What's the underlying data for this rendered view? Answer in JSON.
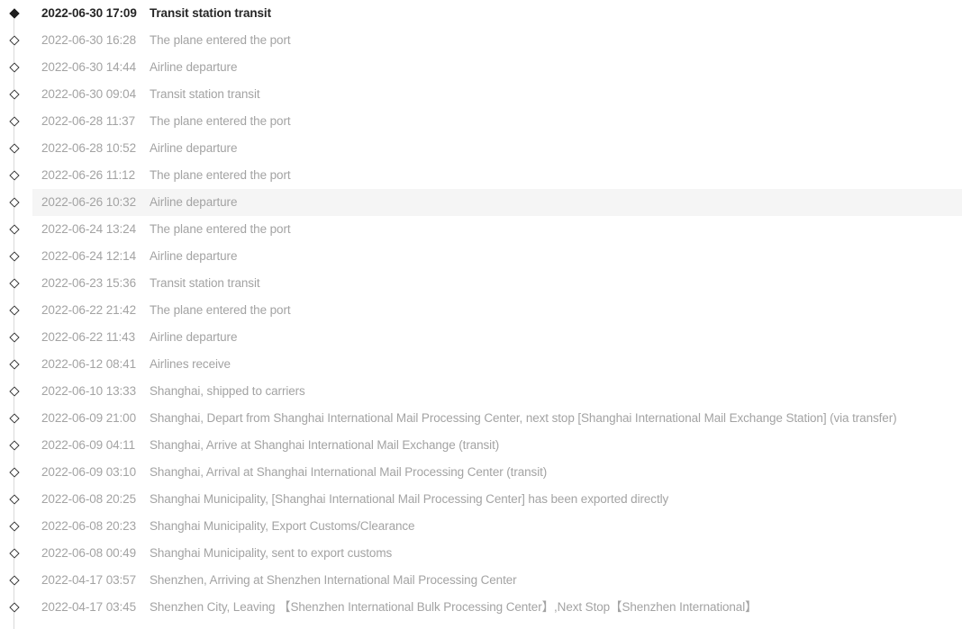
{
  "colors": {
    "active_text": "#262626",
    "muted_text": "#a3a3a3",
    "hover_row_background": "#f5f5f5",
    "connector_line": "#d9d9d9",
    "marker_outline": "#3a3a3a",
    "marker_active_fill": "#1f1f1f",
    "page_background": "#ffffff"
  },
  "timeline": {
    "marker_icon_active": "filled-diamond-icon",
    "marker_icon_inactive": "hollow-diamond-icon",
    "events": [
      {
        "timestamp": "2022-06-30 17:09",
        "description": "Transit station transit",
        "state": "active",
        "hovered": false
      },
      {
        "timestamp": "2022-06-30 16:28",
        "description": "The plane entered the port",
        "state": "past",
        "hovered": false
      },
      {
        "timestamp": "2022-06-30 14:44",
        "description": "Airline departure",
        "state": "past",
        "hovered": false
      },
      {
        "timestamp": "2022-06-30 09:04",
        "description": "Transit station transit",
        "state": "past",
        "hovered": false
      },
      {
        "timestamp": "2022-06-28 11:37",
        "description": "The plane entered the port",
        "state": "past",
        "hovered": false
      },
      {
        "timestamp": "2022-06-28 10:52",
        "description": "Airline departure",
        "state": "past",
        "hovered": false
      },
      {
        "timestamp": "2022-06-26 11:12",
        "description": "The plane entered the port",
        "state": "past",
        "hovered": false
      },
      {
        "timestamp": "2022-06-26 10:32",
        "description": "Airline departure",
        "state": "past",
        "hovered": true
      },
      {
        "timestamp": "2022-06-24 13:24",
        "description": "The plane entered the port",
        "state": "past",
        "hovered": false
      },
      {
        "timestamp": "2022-06-24 12:14",
        "description": "Airline departure",
        "state": "past",
        "hovered": false
      },
      {
        "timestamp": "2022-06-23 15:36",
        "description": "Transit station transit",
        "state": "past",
        "hovered": false
      },
      {
        "timestamp": "2022-06-22 21:42",
        "description": "The plane entered the port",
        "state": "past",
        "hovered": false
      },
      {
        "timestamp": "2022-06-22 11:43",
        "description": "Airline departure",
        "state": "past",
        "hovered": false
      },
      {
        "timestamp": "2022-06-12 08:41",
        "description": "Airlines receive",
        "state": "past",
        "hovered": false
      },
      {
        "timestamp": "2022-06-10 13:33",
        "description": "Shanghai, shipped to carriers",
        "state": "past",
        "hovered": false
      },
      {
        "timestamp": "2022-06-09 21:00",
        "description": "Shanghai, Depart from Shanghai International Mail Processing Center, next stop [Shanghai International Mail Exchange Station] (via transfer)",
        "state": "past",
        "hovered": false
      },
      {
        "timestamp": "2022-06-09 04:11",
        "description": "Shanghai, Arrive at Shanghai International Mail Exchange (transit)",
        "state": "past",
        "hovered": false
      },
      {
        "timestamp": "2022-06-09 03:10",
        "description": "Shanghai, Arrival at Shanghai International Mail Processing Center (transit)",
        "state": "past",
        "hovered": false
      },
      {
        "timestamp": "2022-06-08 20:25",
        "description": "Shanghai Municipality, [Shanghai International Mail Processing Center] has been exported directly",
        "state": "past",
        "hovered": false
      },
      {
        "timestamp": "2022-06-08 20:23",
        "description": "Shanghai Municipality, Export Customs/Clearance",
        "state": "past",
        "hovered": false
      },
      {
        "timestamp": "2022-06-08 00:49",
        "description": "Shanghai Municipality, sent to export customs",
        "state": "past",
        "hovered": false
      },
      {
        "timestamp": "2022-04-17 03:57",
        "description": "Shenzhen, Arriving at Shenzhen International Mail Processing Center",
        "state": "past",
        "hovered": false
      },
      {
        "timestamp": "2022-04-17 03:45",
        "description": "Shenzhen City, Leaving 【Shenzhen International Bulk Processing Center】,Next Stop【Shenzhen International】",
        "state": "past",
        "hovered": false
      }
    ]
  }
}
